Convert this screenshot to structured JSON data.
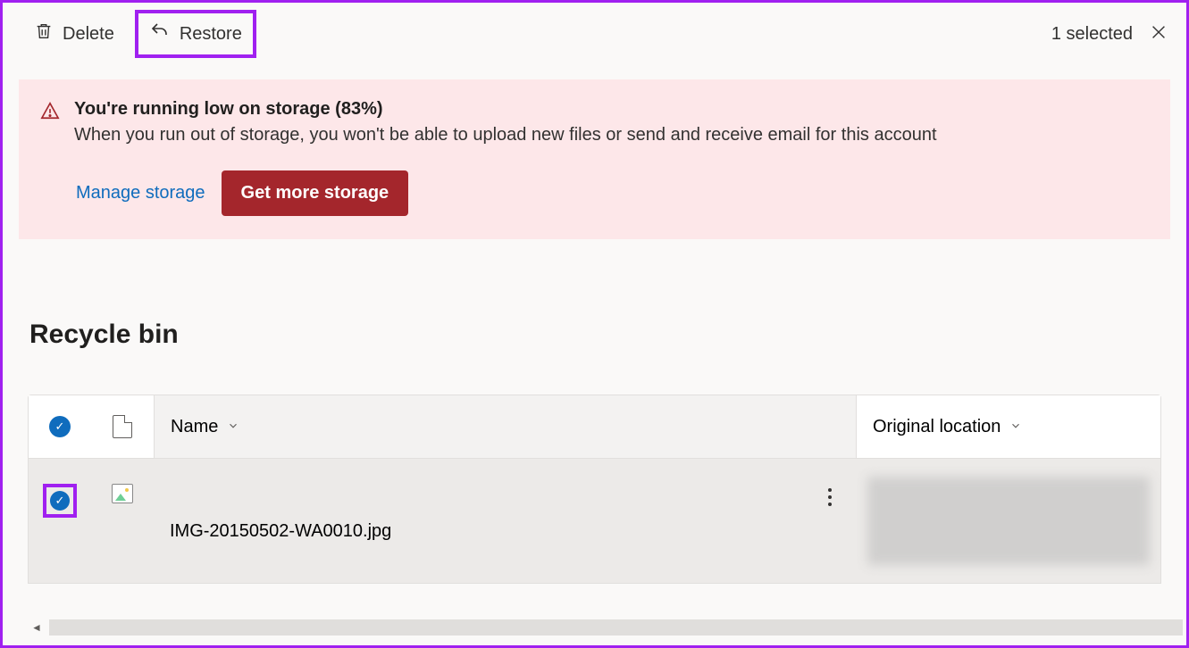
{
  "toolbar": {
    "delete_label": "Delete",
    "restore_label": "Restore",
    "selection_text": "1 selected"
  },
  "banner": {
    "title": "You're running low on storage (83%)",
    "description": "When you run out of storage, you won't be able to upload new files or send and receive email for this account",
    "manage_label": "Manage storage",
    "get_more_label": "Get more storage"
  },
  "page": {
    "title": "Recycle bin"
  },
  "table": {
    "headers": {
      "name": "Name",
      "location": "Original location"
    },
    "rows": [
      {
        "name": "IMG-20150502-WA0010.jpg",
        "selected": true
      }
    ]
  }
}
